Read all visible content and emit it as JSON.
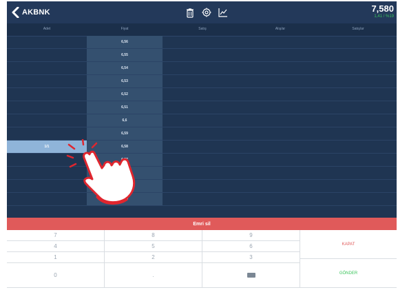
{
  "header": {
    "symbol": "AKBNK",
    "price": "7,580",
    "sub": "1,41 / %19",
    "icons": [
      "trash-icon",
      "gear-icon",
      "chart-icon"
    ]
  },
  "columns": [
    "Adet",
    "Fiyat",
    "Satış",
    "Alış/ar",
    "Satış/ar"
  ],
  "prices": [
    "6,56",
    "6,55",
    "6,54",
    "6,53",
    "6,52",
    "6,51",
    "6,6",
    "6,59",
    "6,58",
    "6,57",
    "6,56",
    "6,55",
    "6,54"
  ],
  "highlight": {
    "qty": "1/1"
  },
  "order_bar": {
    "label": "Emri sil"
  },
  "keypad": {
    "rows": [
      [
        "7",
        "8",
        "9"
      ],
      [
        "4",
        "5",
        "6"
      ],
      [
        "1",
        "2",
        "3"
      ],
      [
        "0",
        ".",
        ""
      ]
    ],
    "close_label": "KAPAT",
    "send_label": "GÖNDER"
  },
  "colors": {
    "background": "#1f3552",
    "price_col": "#34506f",
    "accent_red": "#e05a5a",
    "accent_green": "#39c45a"
  }
}
